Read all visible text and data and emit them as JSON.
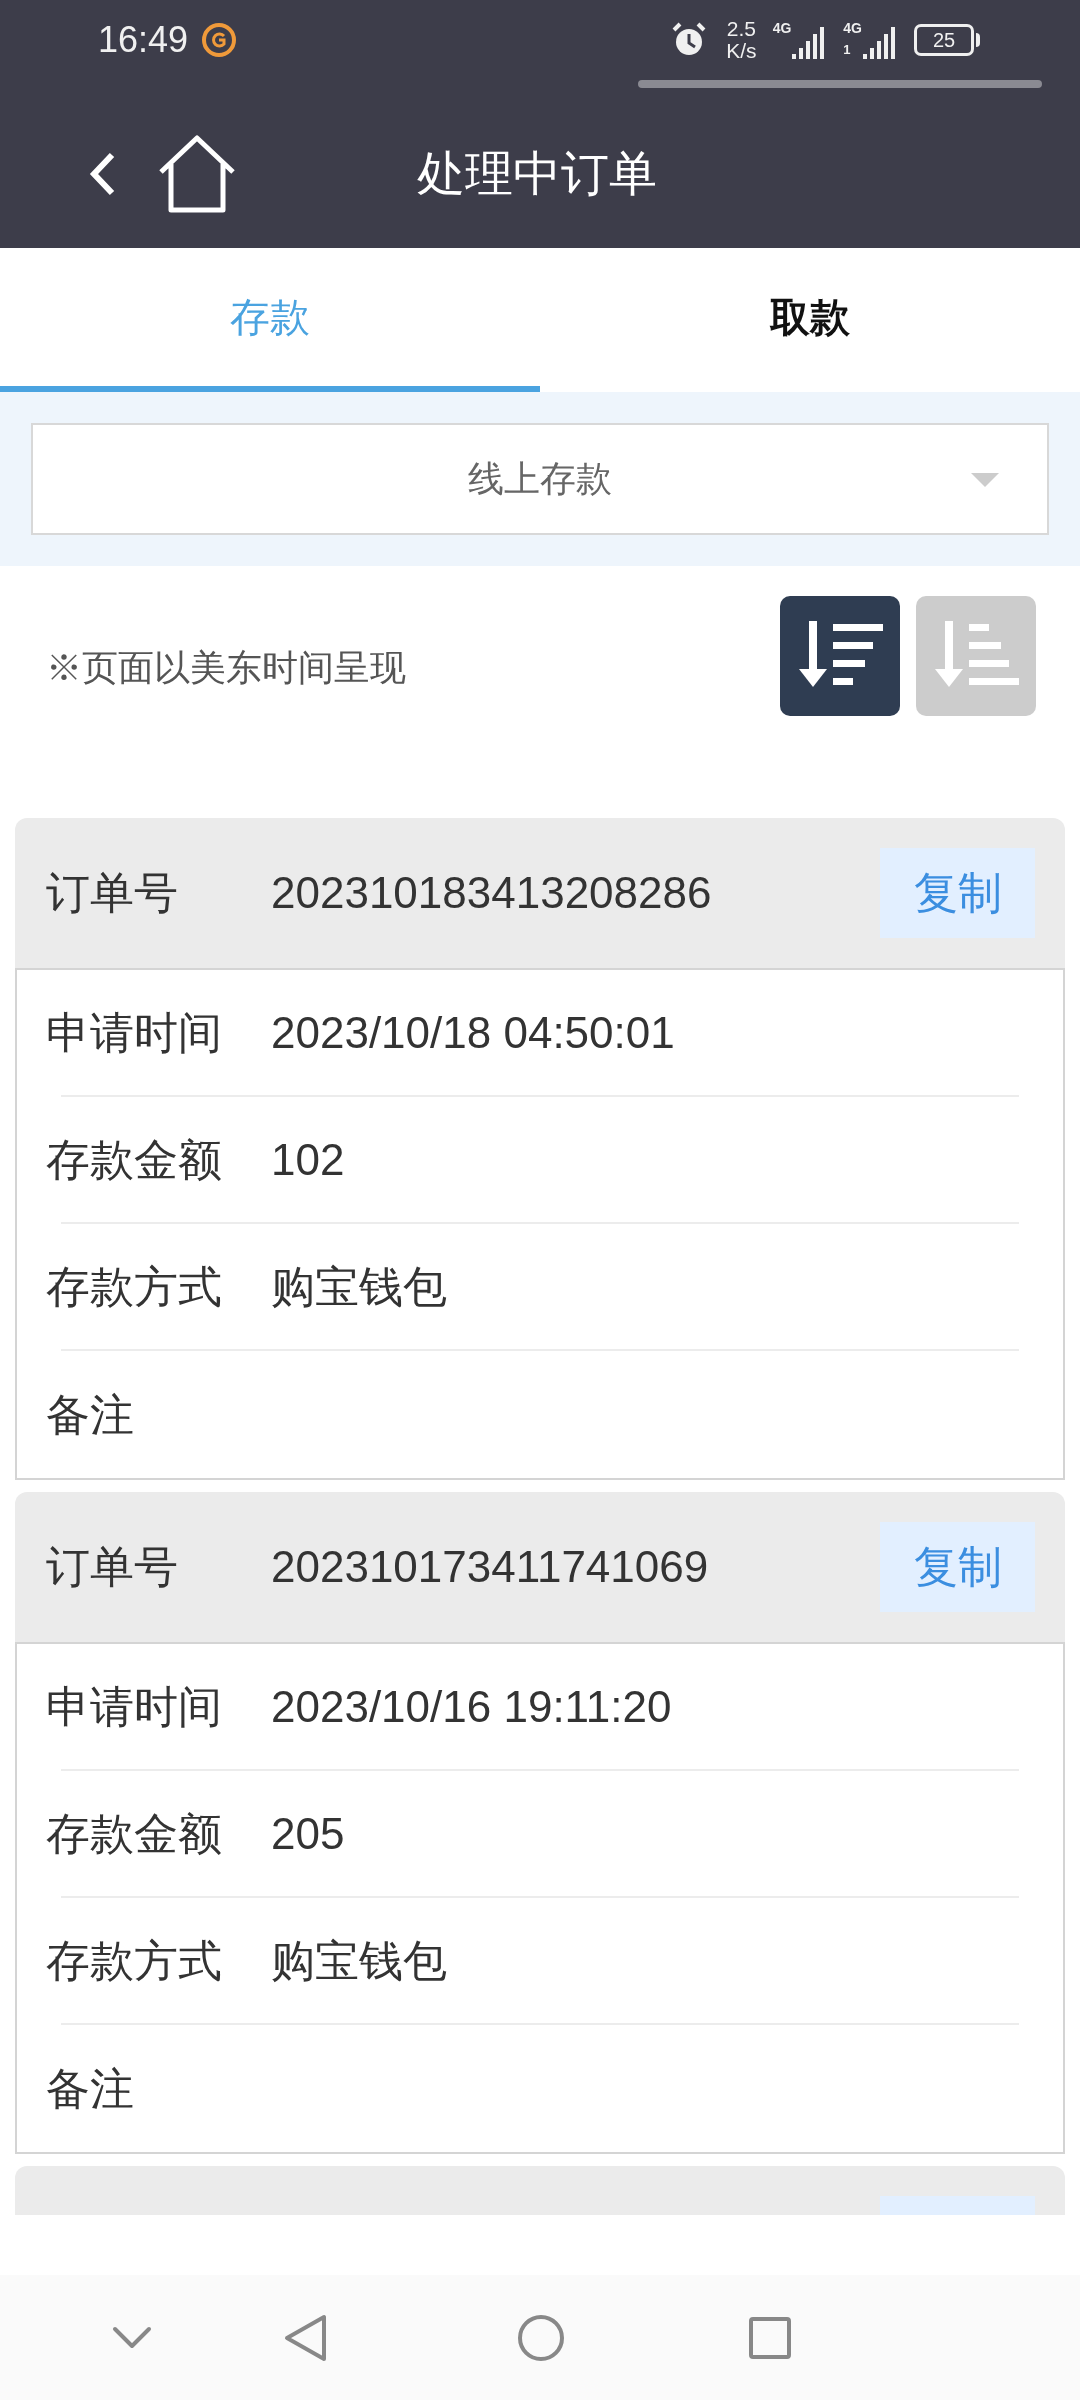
{
  "status_bar": {
    "time": "16:49",
    "speed_value": "2.5",
    "speed_unit": "K/s",
    "network_1": "4G",
    "network_2": "4G",
    "sim_2_label": "1",
    "battery": "25"
  },
  "header": {
    "title": "处理中订单"
  },
  "tabs": [
    {
      "label": "存款",
      "selected": true
    },
    {
      "label": "取款",
      "selected": false
    }
  ],
  "filter": {
    "value": "线上存款"
  },
  "note": "※页面以美东时间呈现",
  "sort_buttons": [
    {
      "kind": "descending",
      "selected": true
    },
    {
      "kind": "ascending",
      "selected": false
    }
  ],
  "orders": [
    {
      "order_label": "订单号",
      "order_no": "202310183413208286",
      "copy": "复制",
      "fields": [
        {
          "label": "申请时间",
          "value": "2023/10/18 04:50:01"
        },
        {
          "label": "存款金额",
          "value": "102"
        },
        {
          "label": "存款方式",
          "value": "购宝钱包"
        },
        {
          "label": "备注"
        }
      ]
    },
    {
      "order_label": "订单号",
      "order_no": "202310173411741069",
      "copy": "复制",
      "fields": [
        {
          "label": "申请时间",
          "value": "2023/10/16 19:11:20"
        },
        {
          "label": "存款金额",
          "value": "205"
        },
        {
          "label": "存款方式",
          "value": "购宝钱包"
        },
        {
          "label": "备注"
        }
      ]
    }
  ]
}
